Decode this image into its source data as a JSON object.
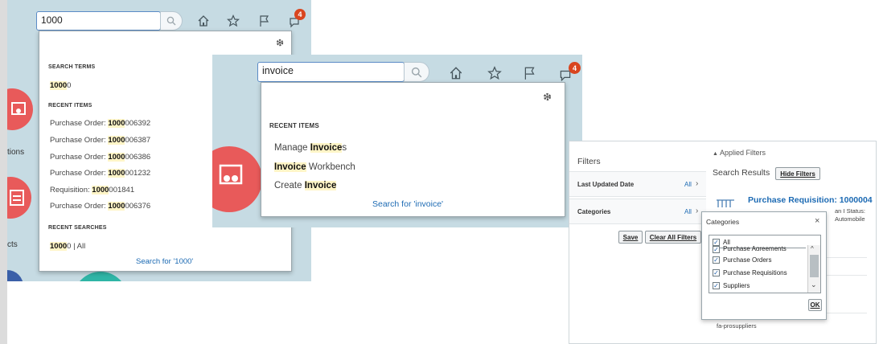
{
  "panel1": {
    "search_value": "1000",
    "badge_count": "4",
    "sections": {
      "search_terms": "SEARCH TERMS",
      "recent_items": "RECENT ITEMS",
      "recent_searches": "RECENT SEARCHES"
    },
    "search_terms": [
      {
        "hl": "1000",
        "rest": "0"
      }
    ],
    "recent_items": [
      {
        "prefix": "Purchase Order: ",
        "hl": "1000",
        "rest": "006392"
      },
      {
        "prefix": "Purchase Order: ",
        "hl": "1000",
        "rest": "006387"
      },
      {
        "prefix": "Purchase Order: ",
        "hl": "1000",
        "rest": "006386"
      },
      {
        "prefix": "Purchase Order: ",
        "hl": "1000",
        "rest": "001232"
      },
      {
        "prefix": "Requisition: ",
        "hl": "1000",
        "rest": "001841"
      },
      {
        "prefix": "Purchase Order: ",
        "hl": "1000",
        "rest": "006376"
      }
    ],
    "recent_searches": [
      {
        "hl": "1000",
        "rest": "0 | All"
      }
    ],
    "search_for": "Search for '1000'",
    "side_labels": {
      "a": "tions",
      "b": "cts"
    }
  },
  "panel2": {
    "search_value": "invoice",
    "badge_count": "4",
    "sections": {
      "recent_items": "RECENT ITEMS"
    },
    "recent_items": [
      {
        "prefix": "Manage ",
        "hl": "Invoice",
        "rest": "s"
      },
      {
        "prefix": "",
        "hl": "Invoice",
        "rest": " Workbench"
      },
      {
        "prefix": "Create ",
        "hl": "Invoice",
        "rest": ""
      }
    ],
    "search_for": "Search for 'invoice'"
  },
  "panel3": {
    "filters_title": "Filters",
    "applied_filters": "Applied Filters",
    "filter_rows": [
      {
        "label": "Last Updated Date",
        "value": "All"
      },
      {
        "label": "Categories",
        "value": "All"
      }
    ],
    "save_label": "Save",
    "clear_label": "Clear All Filters",
    "search_results": "Search Results",
    "hide_filters": "Hide Filters",
    "result_title": "Purchase Requisition: 1000004",
    "result_meta1": "an I Status:",
    "result_meta2": "Automobile",
    "categories_popup": {
      "title": "Categories",
      "close": "×",
      "items": [
        {
          "label": "All",
          "checked": true
        },
        {
          "label": "Purchase Agreements",
          "checked": true
        },
        {
          "label": "Purchase Orders",
          "checked": true
        },
        {
          "label": "Purchase Requisitions",
          "checked": true
        },
        {
          "label": "Suppliers",
          "checked": true
        }
      ],
      "ok_label": "OK"
    },
    "footer_item": "fa-prosuppliers"
  },
  "colors": {
    "panel_bg": "#c6dbe3",
    "highlight": "#fff5c7",
    "link": "#1c6ab3",
    "badge": "#d9451f",
    "red_circle": "#e85a5a",
    "teal_circle": "#2fb5a6",
    "navy_circle": "#3a5fa8"
  }
}
